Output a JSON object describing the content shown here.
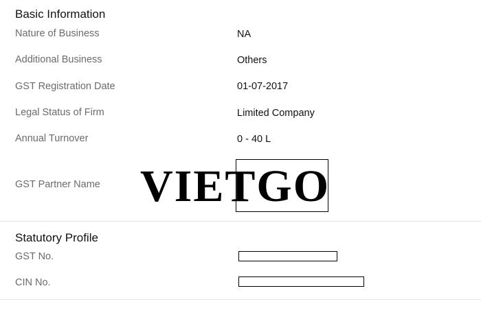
{
  "basic_information": {
    "title": "Basic Information",
    "rows": [
      {
        "label": "Nature of Business",
        "value": "NA"
      },
      {
        "label": "Additional Business",
        "value": "Others"
      },
      {
        "label": "GST Registration Date",
        "value": "01-07-2017"
      },
      {
        "label": "Legal Status of Firm",
        "value": "Limited Company"
      },
      {
        "label": "Annual Turnover",
        "value": "0 - 40 L"
      },
      {
        "label": "GST Partner Name",
        "value": ""
      }
    ]
  },
  "watermark": {
    "text": "VIETGO"
  },
  "statutory_profile": {
    "title": "Statutory Profile",
    "rows": [
      {
        "label": "GST No.",
        "value": ""
      },
      {
        "label": "CIN No.",
        "value": ""
      }
    ]
  }
}
